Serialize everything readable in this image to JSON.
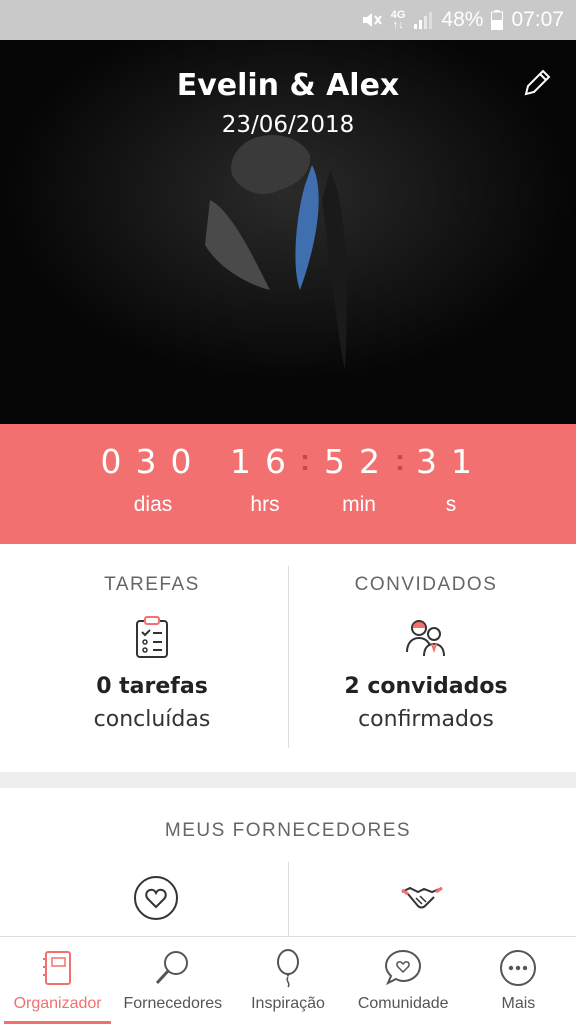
{
  "status_bar": {
    "network_top": "4G",
    "network_bottom": "↑↓",
    "battery": "48%",
    "time": "07:07",
    "icons": [
      "mute-icon",
      "signal-icon",
      "battery-icon"
    ]
  },
  "hero": {
    "names": "Evelin & Alex",
    "date": "23/06/2018",
    "edit_icon": "pencil-icon"
  },
  "countdown": {
    "days": "030",
    "hours": "16",
    "minutes": "52",
    "seconds": "31",
    "separator": ":",
    "days_label": "dias",
    "hours_label": "hrs",
    "minutes_label": "min",
    "seconds_label": "s"
  },
  "stats": {
    "tasks": {
      "title": "TAREFAS",
      "icon": "clipboard-checklist-icon",
      "value": "0 tarefas",
      "sub": "concluídas"
    },
    "guests": {
      "title": "CONVIDADOS",
      "icon": "guests-couple-icon",
      "value": "2 convidados",
      "sub": "confirmados"
    }
  },
  "providers": {
    "title": "MEUS FORNECEDORES",
    "icons": [
      "heart-circle-icon",
      "handshake-icon"
    ]
  },
  "nav": {
    "items": [
      {
        "label": "Organizador",
        "icon": "planner-book-icon",
        "active": true
      },
      {
        "label": "Fornecedores",
        "icon": "magnifier-icon",
        "active": false
      },
      {
        "label": "Inspiração",
        "icon": "balloon-icon",
        "active": false
      },
      {
        "label": "Comunidade",
        "icon": "chat-heart-icon",
        "active": false
      },
      {
        "label": "Mais",
        "icon": "more-dots-icon",
        "active": false
      }
    ]
  },
  "colors": {
    "accent": "#f2706f",
    "separator": "#c94747",
    "status_bar": "#c9c9c9",
    "hero_bg": "#050505"
  }
}
